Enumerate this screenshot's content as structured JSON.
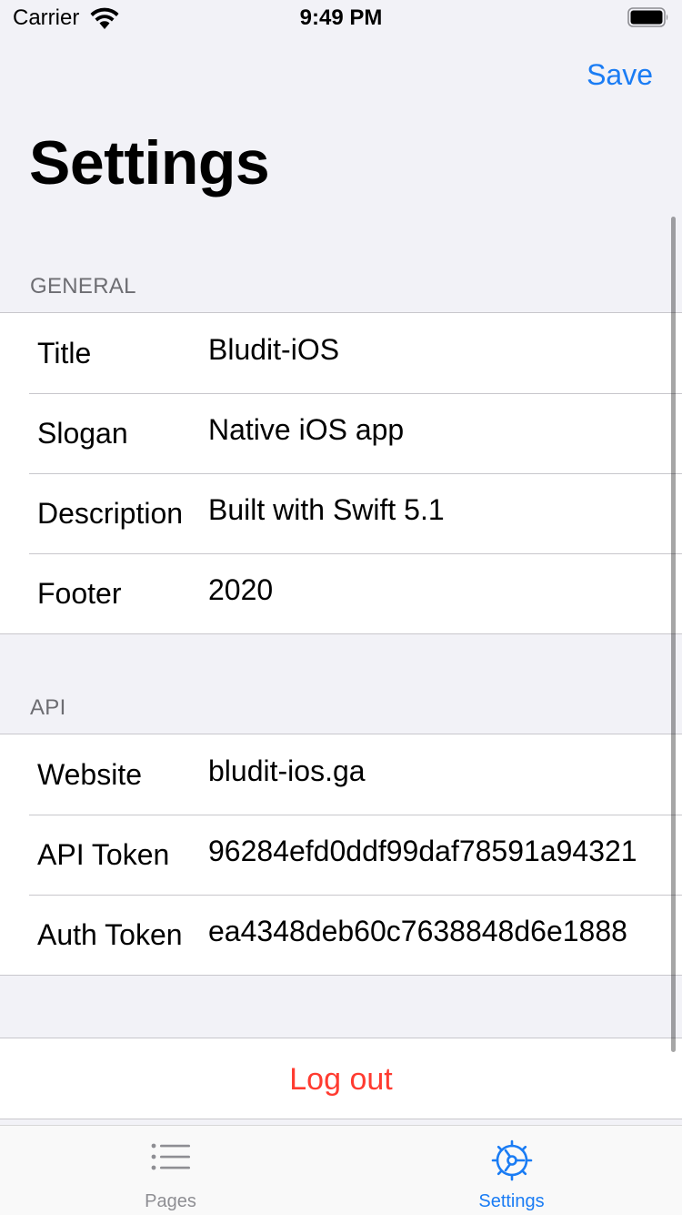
{
  "status_bar": {
    "carrier": "Carrier",
    "time": "9:49 PM"
  },
  "nav": {
    "save_label": "Save",
    "title": "Settings"
  },
  "sections": {
    "general": {
      "header": "GENERAL",
      "rows": [
        {
          "label": "Title",
          "value": "Bludit-iOS"
        },
        {
          "label": "Slogan",
          "value": "Native iOS app"
        },
        {
          "label": "Description",
          "value": "Built with Swift 5.1"
        },
        {
          "label": "Footer",
          "value": "2020"
        }
      ]
    },
    "api": {
      "header": "API",
      "rows": [
        {
          "label": "Website",
          "value": "bludit-ios.ga"
        },
        {
          "label": "API Token",
          "value": "96284efd0ddf99daf78591a94321"
        },
        {
          "label": "Auth Token",
          "value": "ea4348deb60c7638848d6e1888"
        }
      ]
    }
  },
  "logout_label": "Log out",
  "tabs": [
    {
      "label": "Pages",
      "icon": "list-icon",
      "selected": false
    },
    {
      "label": "Settings",
      "icon": "gear-icon",
      "selected": true
    }
  ],
  "colors": {
    "accent": "#1a7cf4",
    "destructive": "#ff3b30",
    "background": "#f2f2f7",
    "inactive_tab": "#8e8e93"
  }
}
